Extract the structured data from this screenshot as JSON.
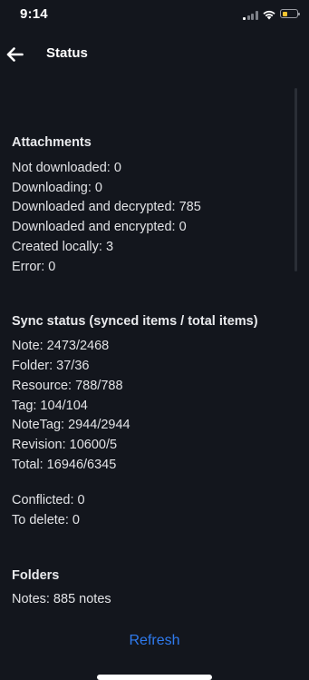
{
  "status_bar": {
    "time": "9:14"
  },
  "header": {
    "title": "Status"
  },
  "attachments": {
    "title": "Attachments",
    "lines": [
      "Not downloaded: 0",
      "Downloading: 0",
      "Downloaded and decrypted: 785",
      "Downloaded and encrypted: 0",
      "Created locally: 3",
      "Error: 0"
    ]
  },
  "sync": {
    "title": "Sync status (synced items / total items)",
    "lines": [
      "Note: 2473/2468",
      "Folder: 37/36",
      "Resource: 788/788",
      "Tag: 104/104",
      "NoteTag: 2944/2944",
      "Revision: 10600/5",
      "Total: 16946/6345"
    ],
    "extra": [
      "Conflicted: 0",
      "To delete: 0"
    ]
  },
  "folders": {
    "title": "Folders",
    "lines": [
      "Notes: 885 notes"
    ]
  },
  "actions": {
    "refresh_label": "Refresh"
  },
  "colors": {
    "background": "#13161d",
    "accent": "#2f7bef",
    "battery": "#f4c430"
  }
}
